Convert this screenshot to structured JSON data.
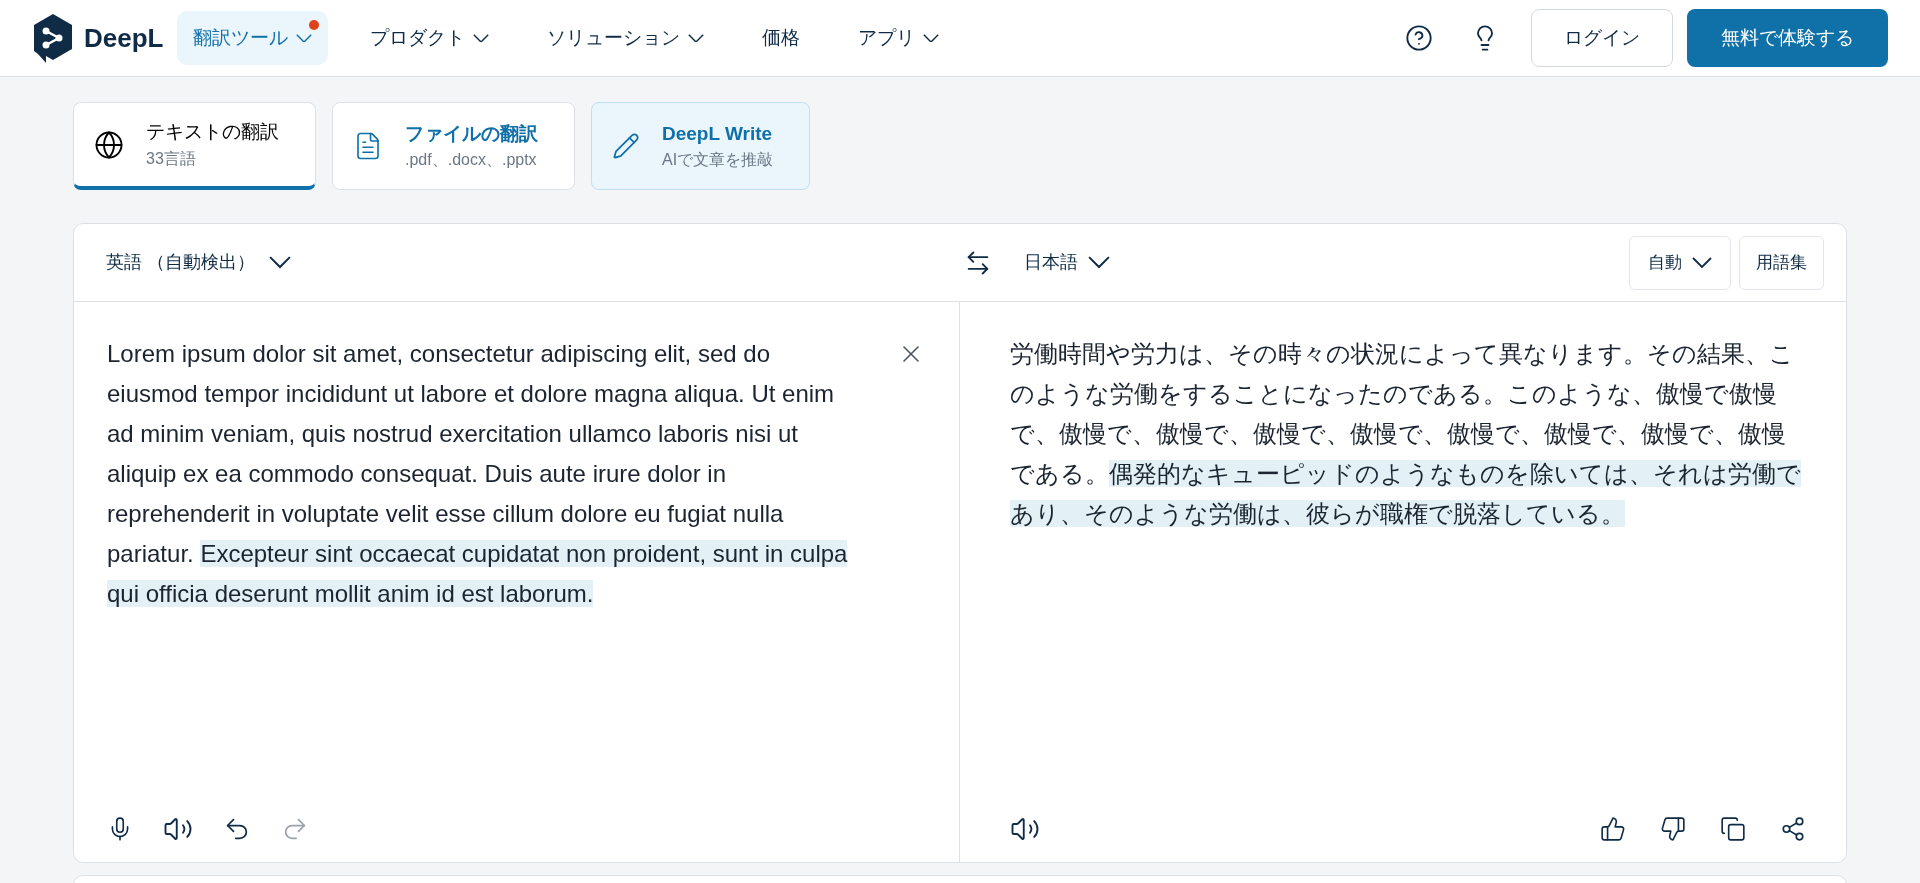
{
  "header": {
    "logo": "DeepL",
    "nav": [
      {
        "label": "翻訳ツール",
        "dropdown": true,
        "selected": true,
        "notification": true
      },
      {
        "label": "プロダクト",
        "dropdown": true,
        "selected": false,
        "notification": false
      },
      {
        "label": "ソリューション",
        "dropdown": true,
        "selected": false,
        "notification": false
      },
      {
        "label": "価格",
        "dropdown": false,
        "selected": false,
        "notification": false
      },
      {
        "label": "アプリ",
        "dropdown": true,
        "selected": false,
        "notification": false
      }
    ],
    "login": "ログイン",
    "signup": "無料で体験する"
  },
  "mode_tabs": [
    {
      "kind": "text",
      "title": "テキストの翻訳",
      "subtitle": "33言語",
      "selected": true
    },
    {
      "kind": "file",
      "title": "ファイルの翻訳",
      "subtitle": ".pdf、.docx、.pptx",
      "selected": false
    },
    {
      "kind": "write",
      "title": "DeepL Write",
      "subtitle": "AIで文章を推敲",
      "selected": false
    }
  ],
  "translator": {
    "source_language": "英語 （自動検出）",
    "target_language": "日本語",
    "formality": "自動",
    "glossary": "用語集",
    "source": {
      "text": "Lorem ipsum dolor sit amet, consectetur adipiscing elit, sed do eiusmod tempor incididunt ut labore et dolore magna aliqua. Ut enim ad minim veniam, quis nostrud exercitation ullamco laboris nisi ut aliquip ex ea commodo consequat. Duis aute irure dolor in reprehenderit in voluptate velit esse cillum dolore eu fugiat nulla pariatur.",
      "highlight": "Excepteur sint occaecat cupidatat non proident, sunt in culpa qui officia deserunt mollit anim id est laborum."
    },
    "target": {
      "text": "労働時間や労力は、その時々の状況によって異なります。その結果、このような労働をすることになったのである。このような、傲慢で傲慢で、傲慢で、傲慢で、傲慢で、傲慢で、傲慢で、傲慢で、傲慢で、傲慢である。",
      "highlight": "偶発的なキューピッドのようなものを除いては、それは労働であり、そのような労働は、彼らが職権で脱落している。"
    },
    "redo_disabled": true
  }
}
